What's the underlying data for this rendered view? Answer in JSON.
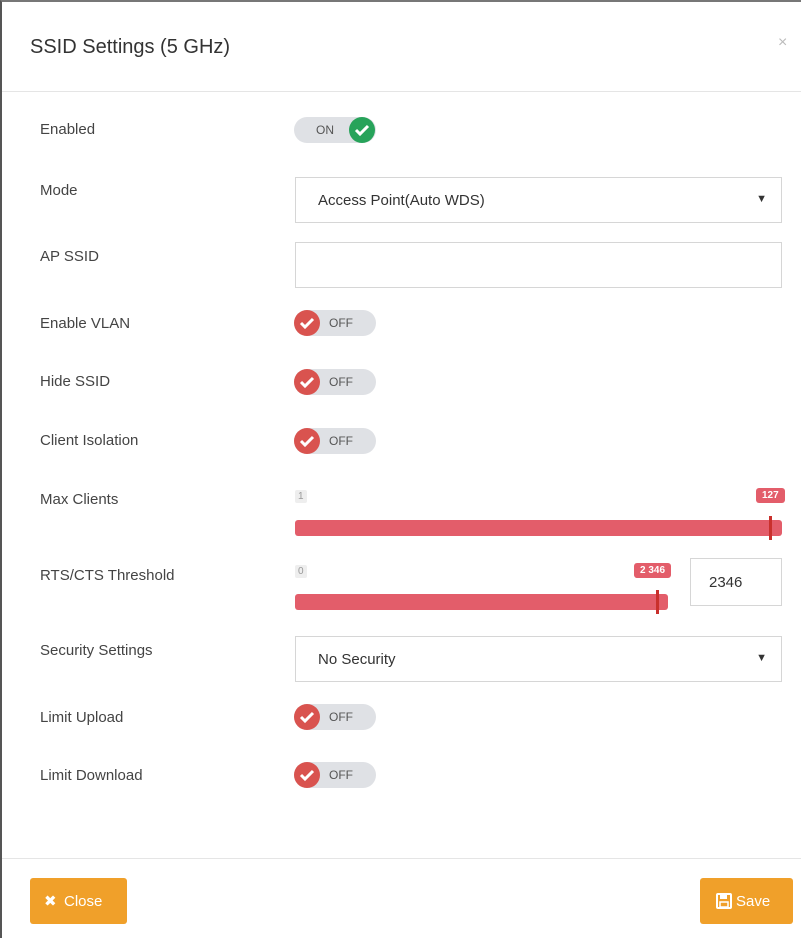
{
  "modal": {
    "title": "SSID Settings (5 GHz)",
    "close_symbol": "×"
  },
  "fields": {
    "enabled": {
      "label": "Enabled",
      "toggle": "ON"
    },
    "mode": {
      "label": "Mode",
      "value": "Access Point(Auto WDS)"
    },
    "ap_ssid": {
      "label": "AP SSID",
      "value": ""
    },
    "enable_vlan": {
      "label": "Enable VLAN",
      "toggle": "OFF"
    },
    "hide_ssid": {
      "label": "Hide SSID",
      "toggle": "OFF"
    },
    "client_isolation": {
      "label": "Client Isolation",
      "toggle": "OFF"
    },
    "max_clients": {
      "label": "Max Clients",
      "min": "1",
      "max_badge": "127",
      "value": 127
    },
    "rts_cts": {
      "label": "RTS/CTS Threshold",
      "min": "0",
      "value_badge": "2 346",
      "input_value": "2346"
    },
    "security": {
      "label": "Security Settings",
      "value": "No Security"
    },
    "limit_upload": {
      "label": "Limit Upload",
      "toggle": "OFF"
    },
    "limit_download": {
      "label": "Limit Download",
      "toggle": "OFF"
    }
  },
  "footer": {
    "close_label": "Close",
    "save_label": "Save"
  },
  "colors": {
    "accent_orange": "#f0a02a",
    "on_green": "#27a35a",
    "off_red": "#d9534f",
    "slider_red": "#e35d6a"
  }
}
